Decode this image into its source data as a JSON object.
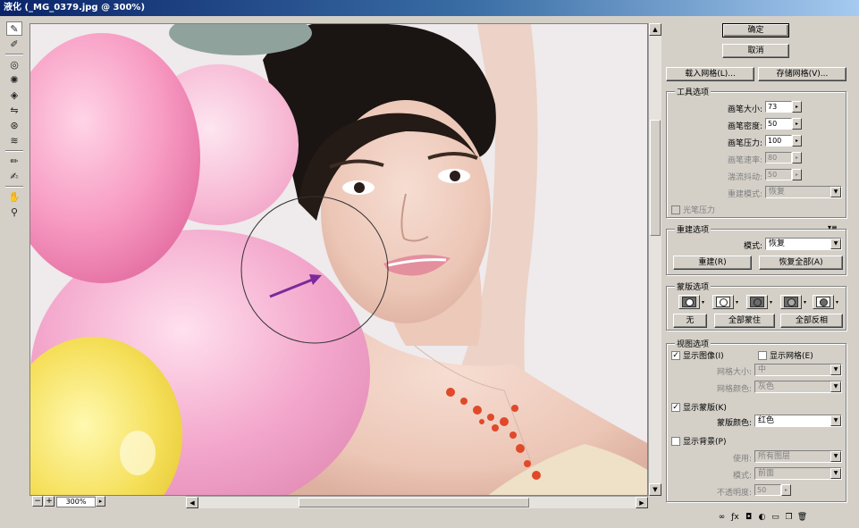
{
  "window": {
    "title": "液化 (_MG_0379.jpg @ 300%)"
  },
  "tools": [
    "warp-icon",
    "reconstruct-icon",
    "twirl-icon",
    "pucker-icon",
    "bloat-icon",
    "push-left-icon",
    "mirror-icon",
    "turbulence-icon",
    "freeze-mask-icon",
    "thaw-mask-icon",
    "hand-icon",
    "zoom-icon"
  ],
  "canvas": {
    "zoom": "300%"
  },
  "buttons": {
    "ok": "确定",
    "cancel": "取消",
    "load_mesh": "载入网格(L)...",
    "save_mesh": "存储网格(V)..."
  },
  "tool_options": {
    "title": "工具选项",
    "brush_size_label": "画笔大小:",
    "brush_size": "73",
    "brush_density_label": "画笔密度:",
    "brush_density": "50",
    "brush_pressure_label": "画笔压力:",
    "brush_pressure": "100",
    "brush_rate_label": "画笔速率:",
    "brush_rate": "80",
    "turbulent_jitter_label": "湍流抖动:",
    "turbulent_jitter": "50",
    "recon_mode_label": "重建模式:",
    "recon_mode": "恢复",
    "stylus_pressure": "光笔压力"
  },
  "reconstruct_options": {
    "title": "重建选项",
    "mode_label": "模式:",
    "mode": "恢复",
    "reconstruct_button": "重建(R)",
    "restore_all_button": "恢复全部(A)"
  },
  "mask_options": {
    "title": "蒙版选项",
    "none_button": "无",
    "mask_all_button": "全部蒙住",
    "invert_all_button": "全部反相"
  },
  "view_options": {
    "title": "视图选项",
    "show_image": "显示图像(I)",
    "show_image_checked": true,
    "show_mesh": "显示网格(E)",
    "show_mesh_checked": false,
    "mesh_size_label": "网格大小:",
    "mesh_size": "中",
    "mesh_color_label": "网格颜色:",
    "mesh_color": "灰色",
    "show_mask": "显示蒙版(K)",
    "show_mask_checked": true,
    "mask_color_label": "蒙版颜色:",
    "mask_color": "红色",
    "show_backdrop": "显示背景(P)",
    "show_backdrop_checked": false,
    "use_label": "使用:",
    "use": "所有图层",
    "mode_label": "模式:",
    "mode": "前面",
    "opacity_label": "不透明度:",
    "opacity": "50"
  },
  "colors": {
    "title_bar": "#0a246a",
    "annotation_arrow": "#7a2a9a",
    "mask_color": "#ff0000"
  }
}
